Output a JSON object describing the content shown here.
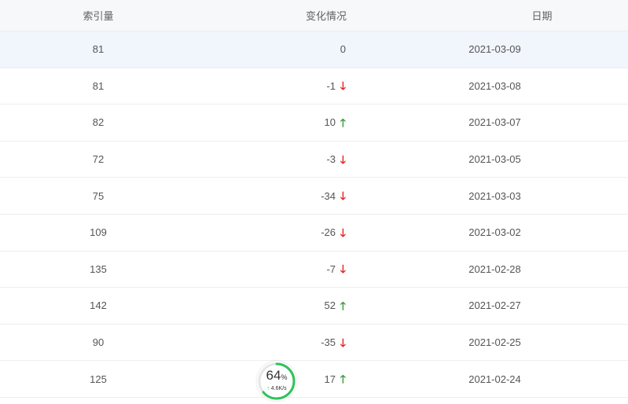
{
  "table": {
    "headers": {
      "index": "索引量",
      "change": "变化情况",
      "date": "日期"
    },
    "rows": [
      {
        "index": "81",
        "change": "0",
        "trend": "none",
        "date": "2021-03-09"
      },
      {
        "index": "81",
        "change": "-1",
        "trend": "down",
        "date": "2021-03-08"
      },
      {
        "index": "82",
        "change": "10",
        "trend": "up",
        "date": "2021-03-07"
      },
      {
        "index": "72",
        "change": "-3",
        "trend": "down",
        "date": "2021-03-05"
      },
      {
        "index": "75",
        "change": "-34",
        "trend": "down",
        "date": "2021-03-03"
      },
      {
        "index": "109",
        "change": "-26",
        "trend": "down",
        "date": "2021-03-02"
      },
      {
        "index": "135",
        "change": "-7",
        "trend": "down",
        "date": "2021-02-28"
      },
      {
        "index": "142",
        "change": "52",
        "trend": "up",
        "date": "2021-02-27"
      },
      {
        "index": "90",
        "change": "-35",
        "trend": "down",
        "date": "2021-02-25"
      },
      {
        "index": "125",
        "change": "17",
        "trend": "up",
        "date": "2021-02-24"
      }
    ],
    "arrows": {
      "up": "🡑",
      "down": "🡓"
    }
  },
  "widget": {
    "percent": "64",
    "percent_symbol": "%",
    "percent_value": 0.64,
    "speed_arrow": "↑",
    "speed": "4.6K/s"
  },
  "colors": {
    "down": "#e02020",
    "up": "#3a9a3a",
    "ring": "#2fc35a",
    "highlight_row": "#f1f5fc"
  }
}
